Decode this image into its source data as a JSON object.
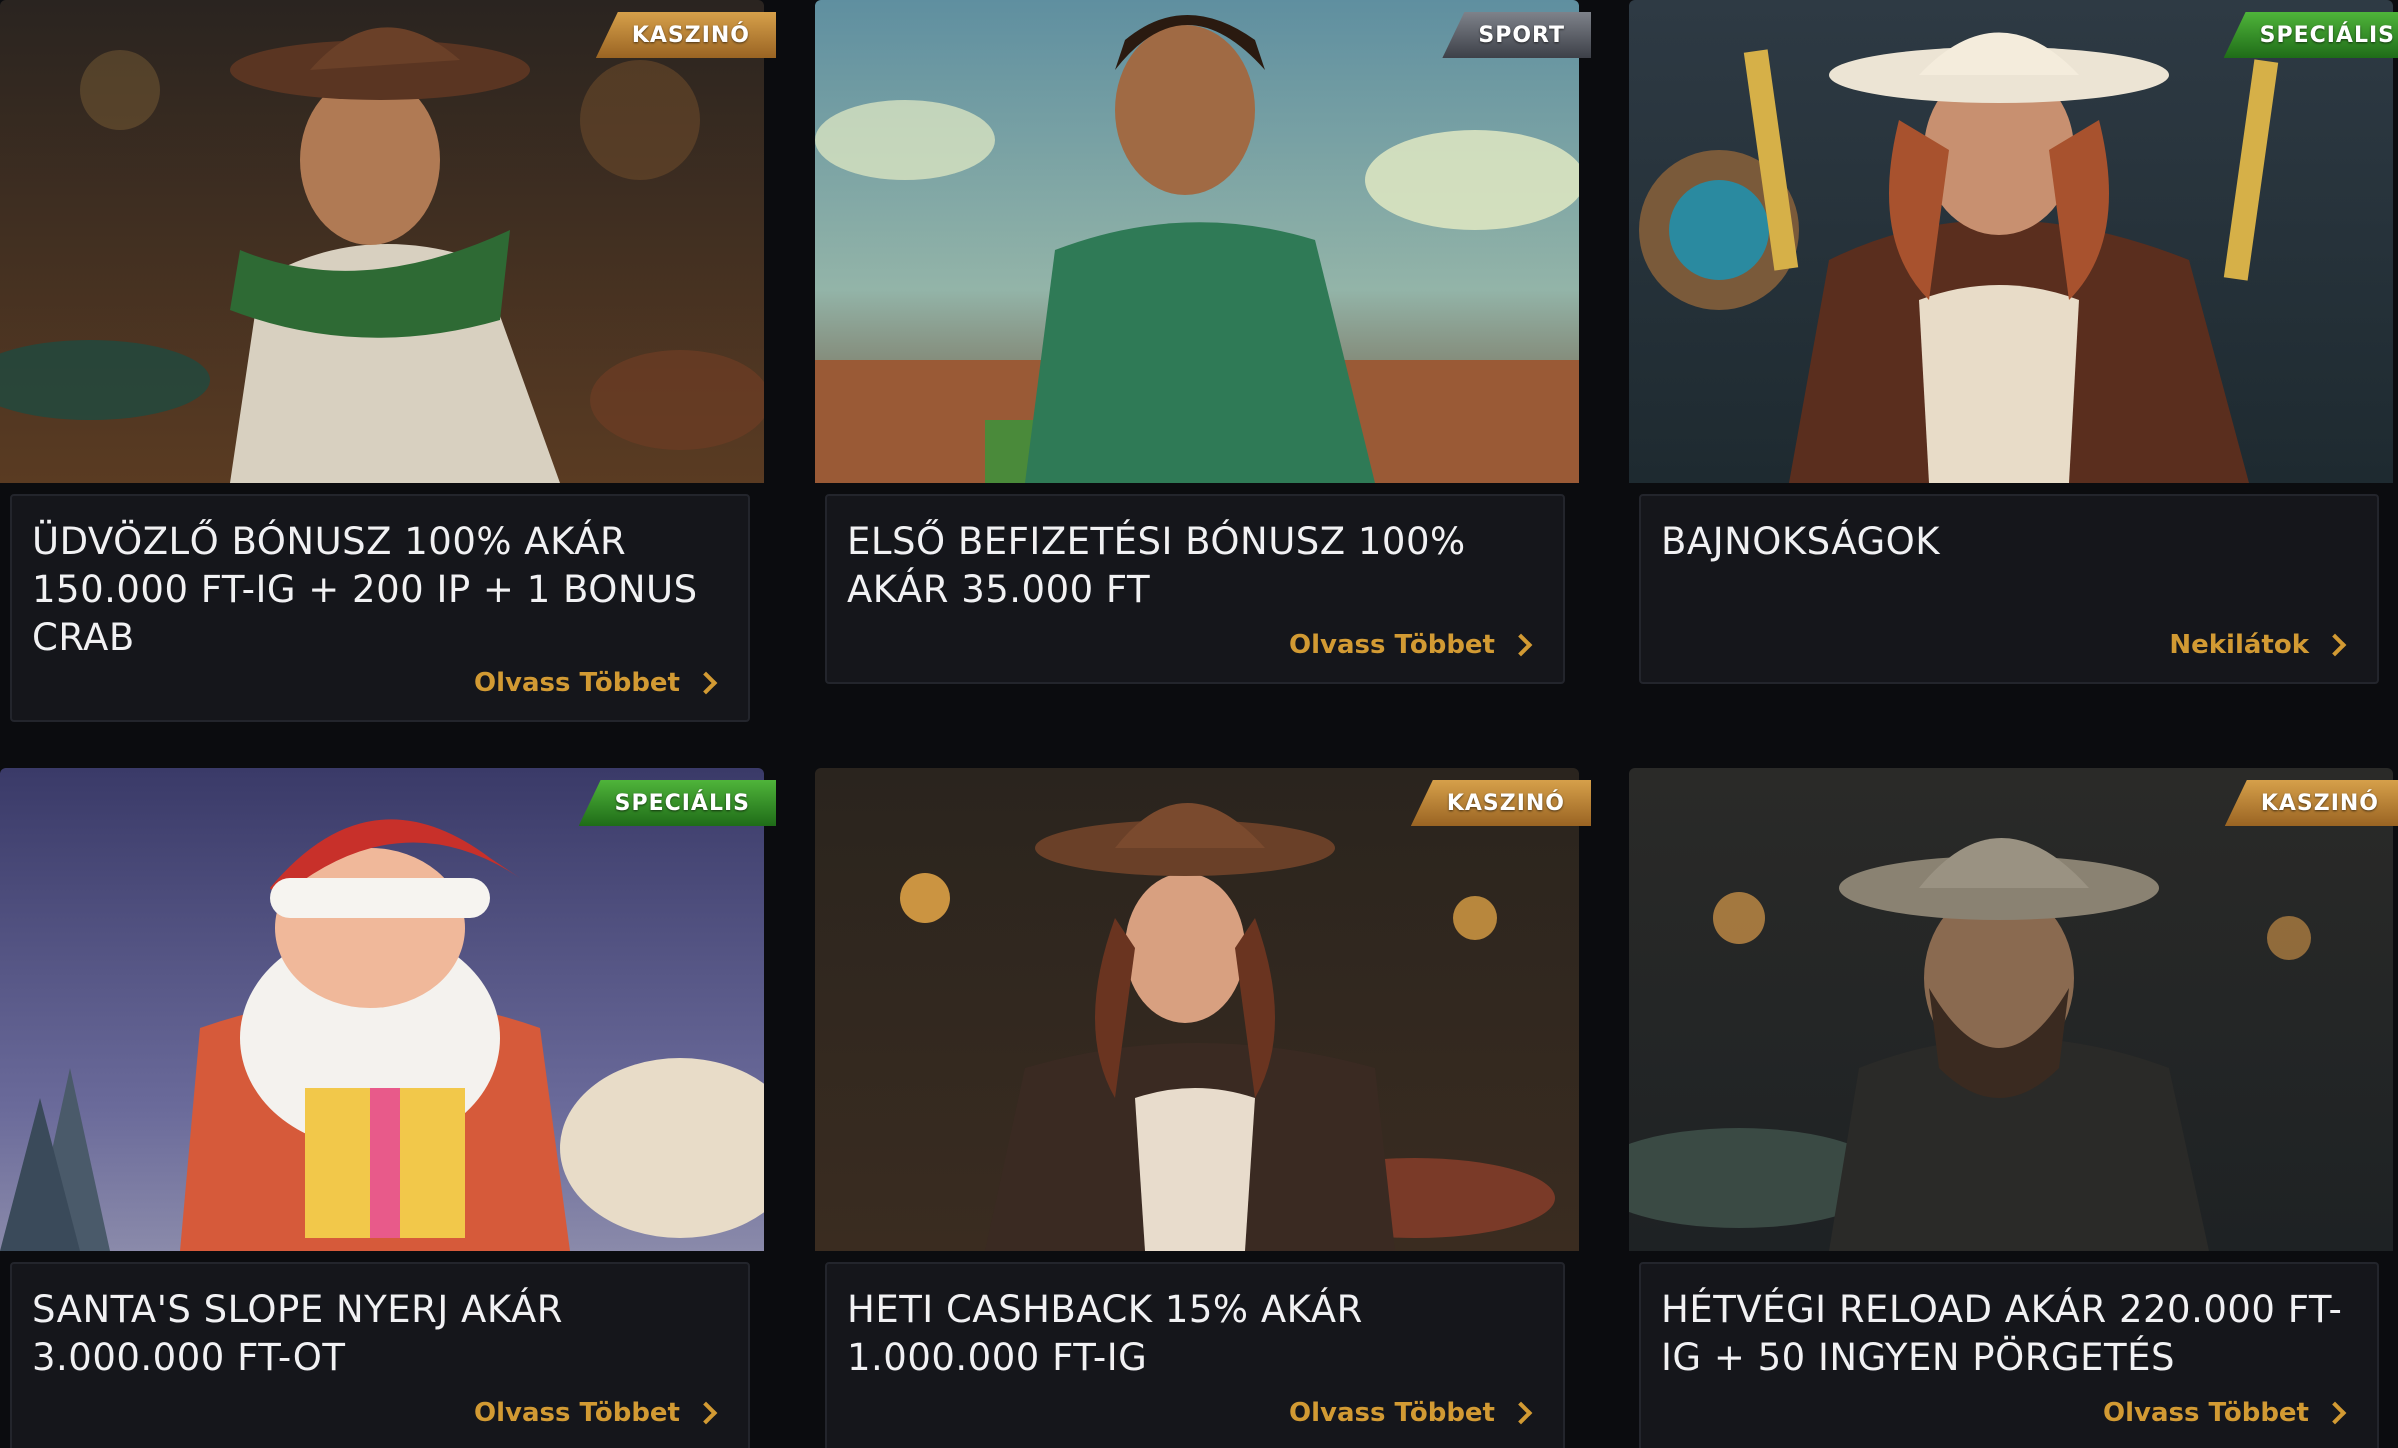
{
  "cards": [
    {
      "badge": "KASZINÓ",
      "badge_type": "kaszino",
      "title": "ÜDVÖZLŐ BÓNUSZ 100% AKÁR 150.000 FT-IG + 200 IP + 1 BONUS CRAB",
      "link_label": "Olvass Többet",
      "image_icon": "cowboy-illustration"
    },
    {
      "badge": "SPORT",
      "badge_type": "sport",
      "title": "ELSŐ BEFIZETÉSI BÓNUSZ 100% AKÁR 35.000 FT",
      "link_label": "Olvass Többet",
      "image_icon": "football-player-illustration"
    },
    {
      "badge": "SPECIÁLIS",
      "badge_type": "specialis",
      "title": "BAJNOKSÁGOK",
      "link_label": "Nekilátok",
      "image_icon": "cowgirl-gunslinger-illustration"
    },
    {
      "badge": "SPECIÁLIS",
      "badge_type": "specialis",
      "title": "SANTA'S SLOPE NYERJ AKÁR 3.000.000 FT-OT",
      "link_label": "Olvass Többet",
      "image_icon": "santa-illustration"
    },
    {
      "badge": "KASZINÓ",
      "badge_type": "kaszino",
      "title": "HETI CASHBACK 15% AKÁR 1.000.000 FT-IG",
      "link_label": "Olvass Többet",
      "image_icon": "cowgirl-illustration"
    },
    {
      "badge": "KASZINÓ",
      "badge_type": "kaszino",
      "title": "HÉTVÉGI RELOAD AKÁR 220.000 FT-IG + 50 INGYEN PÖRGETÉS",
      "link_label": "Olvass Többet",
      "image_icon": "bearded-cowboy-illustration"
    }
  ],
  "colors": {
    "background": "#0b0c0f",
    "card_body": "#15161b",
    "accent_link": "#d29a33",
    "badge_kaszino": "#c48a3a",
    "badge_sport": "#5c6068",
    "badge_specialis": "#3a9a2c"
  }
}
